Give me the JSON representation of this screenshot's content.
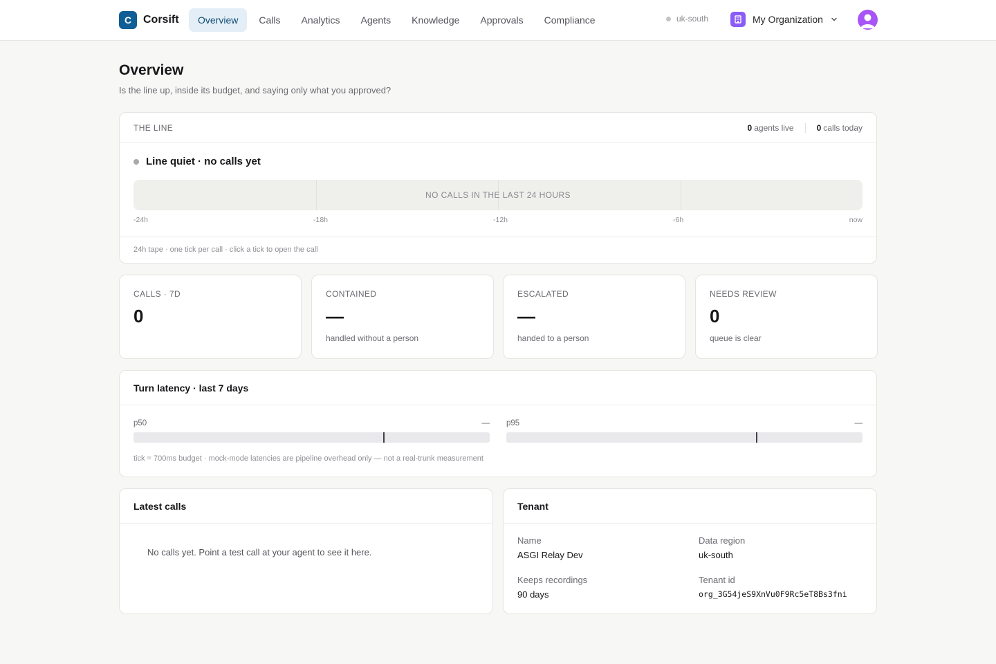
{
  "brand": {
    "logo_letter": "C",
    "name": "Corsift"
  },
  "nav": [
    {
      "label": "Overview",
      "active": true
    },
    {
      "label": "Calls"
    },
    {
      "label": "Analytics"
    },
    {
      "label": "Agents"
    },
    {
      "label": "Knowledge"
    },
    {
      "label": "Approvals"
    },
    {
      "label": "Compliance"
    }
  ],
  "header": {
    "region": "uk-south",
    "org_name": "My Organization",
    "icons": {
      "region": "status-dot-icon",
      "org": "building-icon",
      "dropdown": "chevron-down-icon",
      "avatar": "user-avatar-icon"
    }
  },
  "page": {
    "title": "Overview",
    "subtitle": "Is the line up, inside its budget, and saying only what you approved?"
  },
  "line": {
    "label": "THE LINE",
    "agents_live": {
      "value": "0",
      "label": "agents live"
    },
    "calls_today": {
      "value": "0",
      "label": "calls today"
    },
    "status": "Line quiet · no calls yet",
    "tape_message": "NO CALLS IN THE LAST 24 HOURS",
    "ticks": [
      "-24h",
      "-18h",
      "-12h",
      "-6h",
      "now"
    ],
    "footer": "24h tape · one tick per call · click a tick to open the call"
  },
  "kpis": [
    {
      "label": "CALLS · 7D",
      "value": "0",
      "sub": ""
    },
    {
      "label": "CONTAINED",
      "value": "—",
      "sub": "handled without a person"
    },
    {
      "label": "ESCALATED",
      "value": "—",
      "sub": "handed to a person"
    },
    {
      "label": "NEEDS REVIEW",
      "value": "0",
      "sub": "queue is clear"
    }
  ],
  "latency": {
    "title": "Turn latency · last 7 days",
    "p50": {
      "label": "p50",
      "value": "—",
      "budget_fraction": 0.7
    },
    "p95": {
      "label": "p95",
      "value": "—",
      "budget_fraction": 0.7
    },
    "note": "tick = 700ms budget · mock-mode latencies are pipeline overhead only — not a real-trunk measurement"
  },
  "latest_calls": {
    "title": "Latest calls",
    "empty": "No calls yet. Point a test call at your agent to see it here."
  },
  "tenant": {
    "title": "Tenant",
    "name": {
      "label": "Name",
      "value": "ASGI Relay Dev"
    },
    "region": {
      "label": "Data region",
      "value": "uk-south"
    },
    "recordings": {
      "label": "Keeps recordings",
      "value": "90 days"
    },
    "tenant_id": {
      "label": "Tenant id",
      "value": "org_3G54jeS9XnVu0F9Rc5eT8Bs3fni"
    }
  },
  "colors": {
    "accent": "#0f5f96",
    "nav_active_bg": "#e3eef6",
    "org_icon": "#8b5cf6",
    "avatar": "#a855f7"
  }
}
